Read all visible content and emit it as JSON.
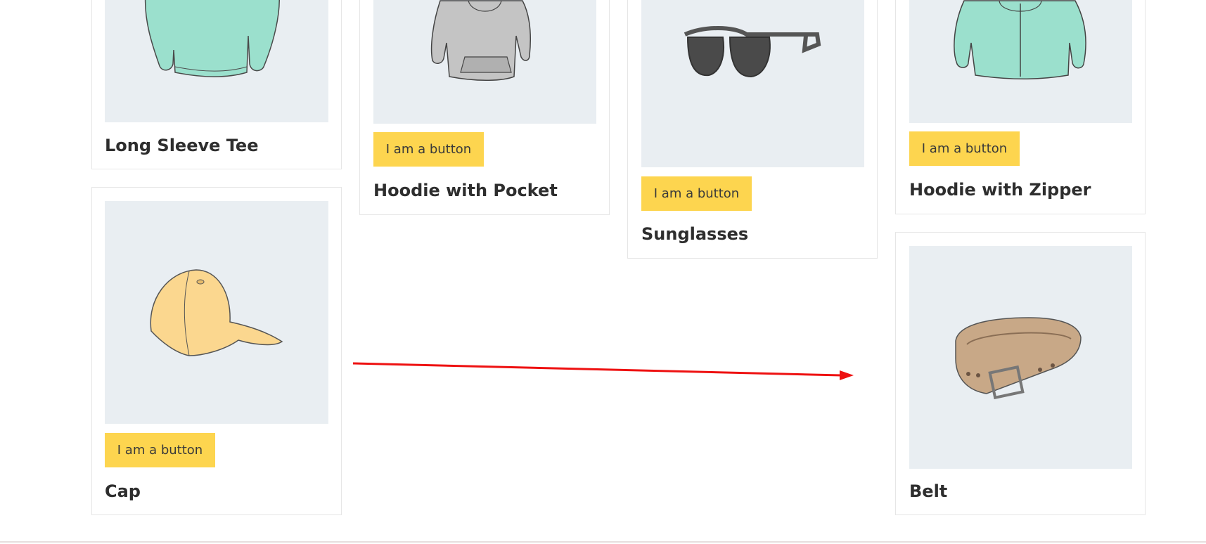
{
  "products": [
    {
      "id": "long-sleeve-tee",
      "title": "Long Sleeve Tee",
      "button_label": "",
      "image_icon": "long-sleeve-tee-icon",
      "image_color": "#9be0cd"
    },
    {
      "id": "hoodie-with-pocket",
      "title": "Hoodie with Pocket",
      "button_label": "I am a button",
      "image_icon": "hoodie-icon",
      "image_color": "#c4c4c4"
    },
    {
      "id": "sunglasses",
      "title": "Sunglasses",
      "button_label": "I am a button",
      "image_icon": "sunglasses-icon",
      "image_color": "#555555"
    },
    {
      "id": "hoodie-with-zipper",
      "title": "Hoodie with Zipper",
      "button_label": "I am a button",
      "image_icon": "zip-hoodie-icon",
      "image_color": "#9be0cd"
    },
    {
      "id": "cap",
      "title": "Cap",
      "button_label": "I am a button",
      "image_icon": "cap-icon",
      "image_color": "#fbd78f"
    },
    {
      "id": "belt",
      "title": "Belt",
      "button_label": "",
      "image_icon": "belt-icon",
      "image_color": "#c8a887"
    }
  ],
  "colors": {
    "button_bg": "#fdd54f",
    "image_bg": "#e9eef2",
    "card_border": "#e6e6e6",
    "annotation_arrow": "#ee1111"
  }
}
